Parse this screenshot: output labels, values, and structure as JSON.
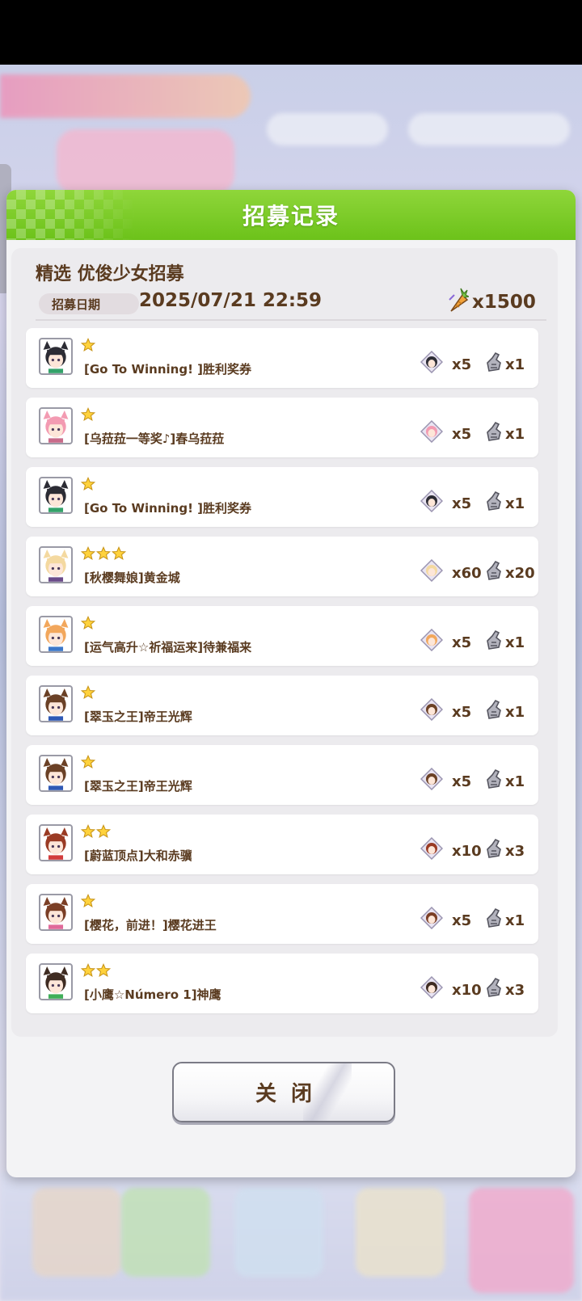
{
  "modal": {
    "title": "招募记录",
    "gacha_name": "精选 优俊少女招募",
    "date_label": "招募日期",
    "date_value": "2025/07/21 22:59",
    "cost": "x1500",
    "close_label": "关闭"
  },
  "records": [
    {
      "stars": 1,
      "name": "[Go To Winning! ]胜利奖券",
      "piece_count": "x5",
      "item_count": "x1",
      "hair": "#2c2c34",
      "ear": "#2c2c34",
      "accent": "#34a26a"
    },
    {
      "stars": 1,
      "name": "[乌菈菈一等奖♪]春乌菈菈",
      "piece_count": "x5",
      "item_count": "x1",
      "hair": "#f39bb2",
      "ear": "#f39bb2",
      "accent": "#c96b8a"
    },
    {
      "stars": 1,
      "name": "[Go To Winning! ]胜利奖券",
      "piece_count": "x5",
      "item_count": "x1",
      "hair": "#2c2c34",
      "ear": "#2c2c34",
      "accent": "#34a26a"
    },
    {
      "stars": 3,
      "name": "[秋樱舞娘]黄金城",
      "piece_count": "x60",
      "item_count": "x20",
      "hair": "#f4d9a0",
      "ear": "#f4d9a0",
      "accent": "#6b4b8a"
    },
    {
      "stars": 1,
      "name": "[运气高升☆祈福运来]待兼福来",
      "piece_count": "x5",
      "item_count": "x1",
      "hair": "#f2a75c",
      "ear": "#f2a75c",
      "accent": "#3d78c9"
    },
    {
      "stars": 1,
      "name": "[翠玉之王]帝王光辉",
      "piece_count": "x5",
      "item_count": "x1",
      "hair": "#6b4126",
      "ear": "#6b4126",
      "accent": "#2f58b4"
    },
    {
      "stars": 1,
      "name": "[翠玉之王]帝王光辉",
      "piece_count": "x5",
      "item_count": "x1",
      "hair": "#6b4126",
      "ear": "#6b4126",
      "accent": "#2f58b4"
    },
    {
      "stars": 2,
      "name": "[蔚蓝顶点]大和赤骥",
      "piece_count": "x10",
      "item_count": "x3",
      "hair": "#9a3b24",
      "ear": "#9a3b24",
      "accent": "#d23b3b"
    },
    {
      "stars": 1,
      "name": "[樱花，前进！]樱花进王",
      "piece_count": "x5",
      "item_count": "x1",
      "hair": "#7b3f26",
      "ear": "#7b3f26",
      "accent": "#e06a9a"
    },
    {
      "stars": 2,
      "name": "[小鹰☆Número 1]神鹰",
      "piece_count": "x10",
      "item_count": "x3",
      "hair": "#3f2c22",
      "ear": "#3f2c22",
      "accent": "#3fae58"
    }
  ]
}
